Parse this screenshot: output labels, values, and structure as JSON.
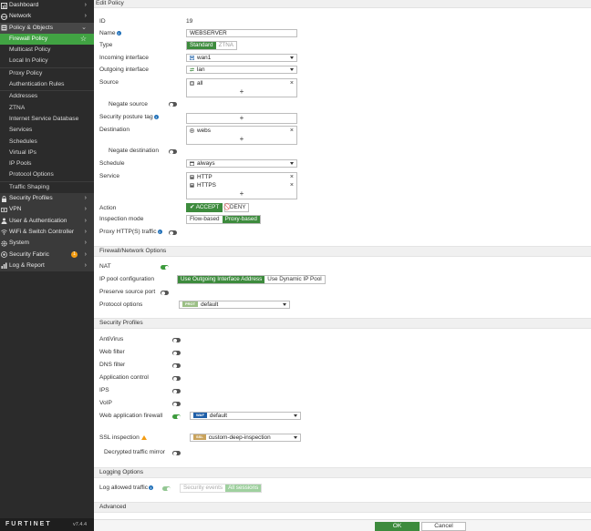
{
  "sidebar": {
    "items": [
      {
        "label": "Dashboard",
        "kind": "top",
        "icon": "dashboard-icon"
      },
      {
        "label": "Network",
        "kind": "top",
        "icon": "network-icon"
      },
      {
        "label": "Policy & Objects",
        "kind": "top-open",
        "icon": "policy-icon"
      },
      {
        "label": "Firewall Policy",
        "kind": "sub-active"
      },
      {
        "label": "Multicast Policy",
        "kind": "sub"
      },
      {
        "label": "Local In Policy",
        "kind": "sub"
      },
      {
        "label": "Proxy Policy",
        "kind": "sub"
      },
      {
        "label": "Authentication Rules",
        "kind": "sub"
      },
      {
        "label": "Addresses",
        "kind": "sub"
      },
      {
        "label": "ZTNA",
        "kind": "sub"
      },
      {
        "label": "Internet Service Database",
        "kind": "sub"
      },
      {
        "label": "Services",
        "kind": "sub"
      },
      {
        "label": "Schedules",
        "kind": "sub"
      },
      {
        "label": "Virtual IPs",
        "kind": "sub"
      },
      {
        "label": "IP Pools",
        "kind": "sub"
      },
      {
        "label": "Protocol Options",
        "kind": "sub"
      },
      {
        "label": "Traffic Shaping",
        "kind": "sub"
      },
      {
        "label": "Security Profiles",
        "kind": "top",
        "icon": "lock-icon"
      },
      {
        "label": "VPN",
        "kind": "top",
        "icon": "vpn-icon"
      },
      {
        "label": "User & Authentication",
        "kind": "top",
        "icon": "user-icon"
      },
      {
        "label": "WiFi & Switch Controller",
        "kind": "top",
        "icon": "wifi-icon"
      },
      {
        "label": "System",
        "kind": "top",
        "icon": "gear-icon"
      },
      {
        "label": "Security Fabric",
        "kind": "top",
        "icon": "fabric-icon",
        "badge": "1"
      },
      {
        "label": "Log & Report",
        "kind": "top",
        "icon": "chart-icon"
      }
    ],
    "brand": "FURTINET",
    "version": "v7.4.4"
  },
  "header": {
    "title": "Edit Policy"
  },
  "form": {
    "id_label": "ID",
    "id_value": "19",
    "name_label": "Name",
    "name_value": "WEBSERVER",
    "type_label": "Type",
    "type_options": [
      "Standard",
      "ZTNA"
    ],
    "incoming_label": "Incoming interface",
    "incoming_value": "wan1",
    "outgoing_label": "Outgoing interface",
    "outgoing_value": "lan",
    "source_label": "Source",
    "source_value": "all",
    "negate_source_label": "Negate source",
    "posture_label": "Security posture tag",
    "destination_label": "Destination",
    "destination_value": "webs",
    "negate_destination_label": "Negate destination",
    "schedule_label": "Schedule",
    "schedule_value": "always",
    "service_label": "Service",
    "service_values": [
      "HTTP",
      "HTTPS"
    ],
    "action_label": "Action",
    "action_accept": "ACCEPT",
    "action_deny": "DENY",
    "inspection_label": "Inspection mode",
    "inspection_options": [
      "Flow-based",
      "Proxy-based"
    ],
    "proxy_label": "Proxy HTTP(S) traffic",
    "add_symbol": "+",
    "remove_symbol": "×"
  },
  "firewall_network": {
    "title": "Firewall/Network Options",
    "nat_label": "NAT",
    "ippool_label": "IP pool configuration",
    "ippool_options": [
      "Use Outgoing Interface Address",
      "Use Dynamic IP Pool"
    ],
    "preserve_label": "Preserve source port",
    "protocol_label": "Protocol options",
    "protocol_tag": "PROT",
    "protocol_value": "default"
  },
  "security_profiles": {
    "title": "Security Profiles",
    "antivirus_label": "AntiVirus",
    "webfilter_label": "Web filter",
    "dnsfilter_label": "DNS filter",
    "appcontrol_label": "Application control",
    "ips_label": "IPS",
    "voip_label": "VoIP",
    "waf_label": "Web application firewall",
    "waf_tag": "WAF",
    "waf_value": "default",
    "ssl_label": "SSL inspection",
    "ssl_tag": "SSL",
    "ssl_value": "custom-deep-inspection",
    "decrypted_label": "Decrypted traffic mirror"
  },
  "logging": {
    "title": "Logging Options",
    "log_label": "Log allowed traffic",
    "log_options": [
      "Security events",
      "All sessions"
    ]
  },
  "advanced": {
    "title": "Advanced"
  },
  "footer": {
    "ok_label": "OK",
    "cancel_label": "Cancel"
  },
  "colors": {
    "accent": "#3d8b3d",
    "sidebar_bg": "#2b2b2b",
    "active_nav": "#41a343",
    "info": "#1f6fb8",
    "warning": "#f39c12"
  }
}
